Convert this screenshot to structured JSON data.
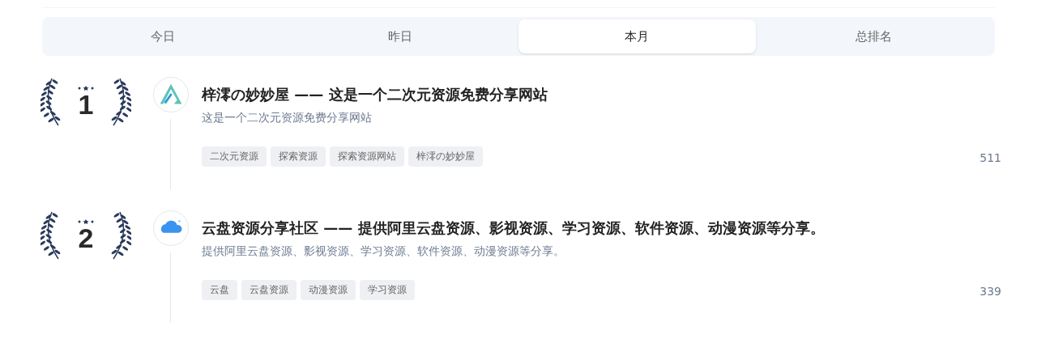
{
  "tabs": [
    {
      "label": "今日",
      "selected": false
    },
    {
      "label": "昨日",
      "selected": false
    },
    {
      "label": "本月",
      "selected": true
    },
    {
      "label": "总排名",
      "selected": false
    }
  ],
  "sites": [
    {
      "rank": "1",
      "kind": "peak",
      "title": "梓澪の妙妙屋 —— 这是一个二次元资源免费分享网站",
      "description": "这是一个二次元资源免费分享网站",
      "tags": [
        "二次元资源",
        "探索资源",
        "探索资源网站",
        "梓澪の妙妙屋"
      ],
      "count": "511"
    },
    {
      "rank": "2",
      "kind": "cloud",
      "title": "云盘资源分享社区 —— 提供阿里云盘资源、影视资源、学习资源、软件资源、动漫资源等分享。",
      "description": "提供阿里云盘资源、影视资源、学习资源、软件资源、动漫资源等分享。",
      "tags": [
        "云盘",
        "云盘资源",
        "动漫资源",
        "学习资源"
      ],
      "count": "339"
    }
  ]
}
